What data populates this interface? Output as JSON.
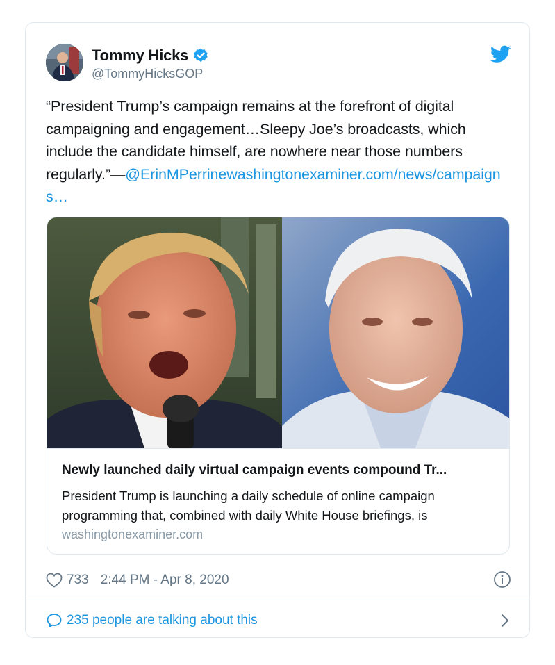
{
  "tweet": {
    "display_name": "Tommy Hicks",
    "handle": "@TommyHicksGOP",
    "text_main": "“President Trump’s campaign remains at the forefront of digital campaigning and engagement…Sleepy Joe’s broadcasts, which include the candidate himself, are nowhere near those numbers regularly.”—",
    "mention": "@ErinMPerrine",
    "link": "washingtonexaminer.com/news/campaigns…",
    "likes": "733",
    "timestamp": "2:44 PM - Apr 8, 2020",
    "conversation": "235 people are talking about this"
  },
  "link_card": {
    "title": "Newly launched daily virtual campaign events compound Tr...",
    "description": "President Trump is launching a daily schedule of online campaign programming that, combined with daily White House briefings, is",
    "domain": "washingtonexaminer.com"
  },
  "icons": {
    "verified": "verified-badge-icon",
    "brand": "twitter-bird-icon",
    "like": "heart-icon",
    "info": "info-icon",
    "reply": "speech-bubble-icon",
    "more": "chevron-right-icon"
  },
  "colors": {
    "accent": "#1da1f2",
    "link": "#1b95e0",
    "muted": "#657786",
    "border": "#e1e8ed"
  }
}
